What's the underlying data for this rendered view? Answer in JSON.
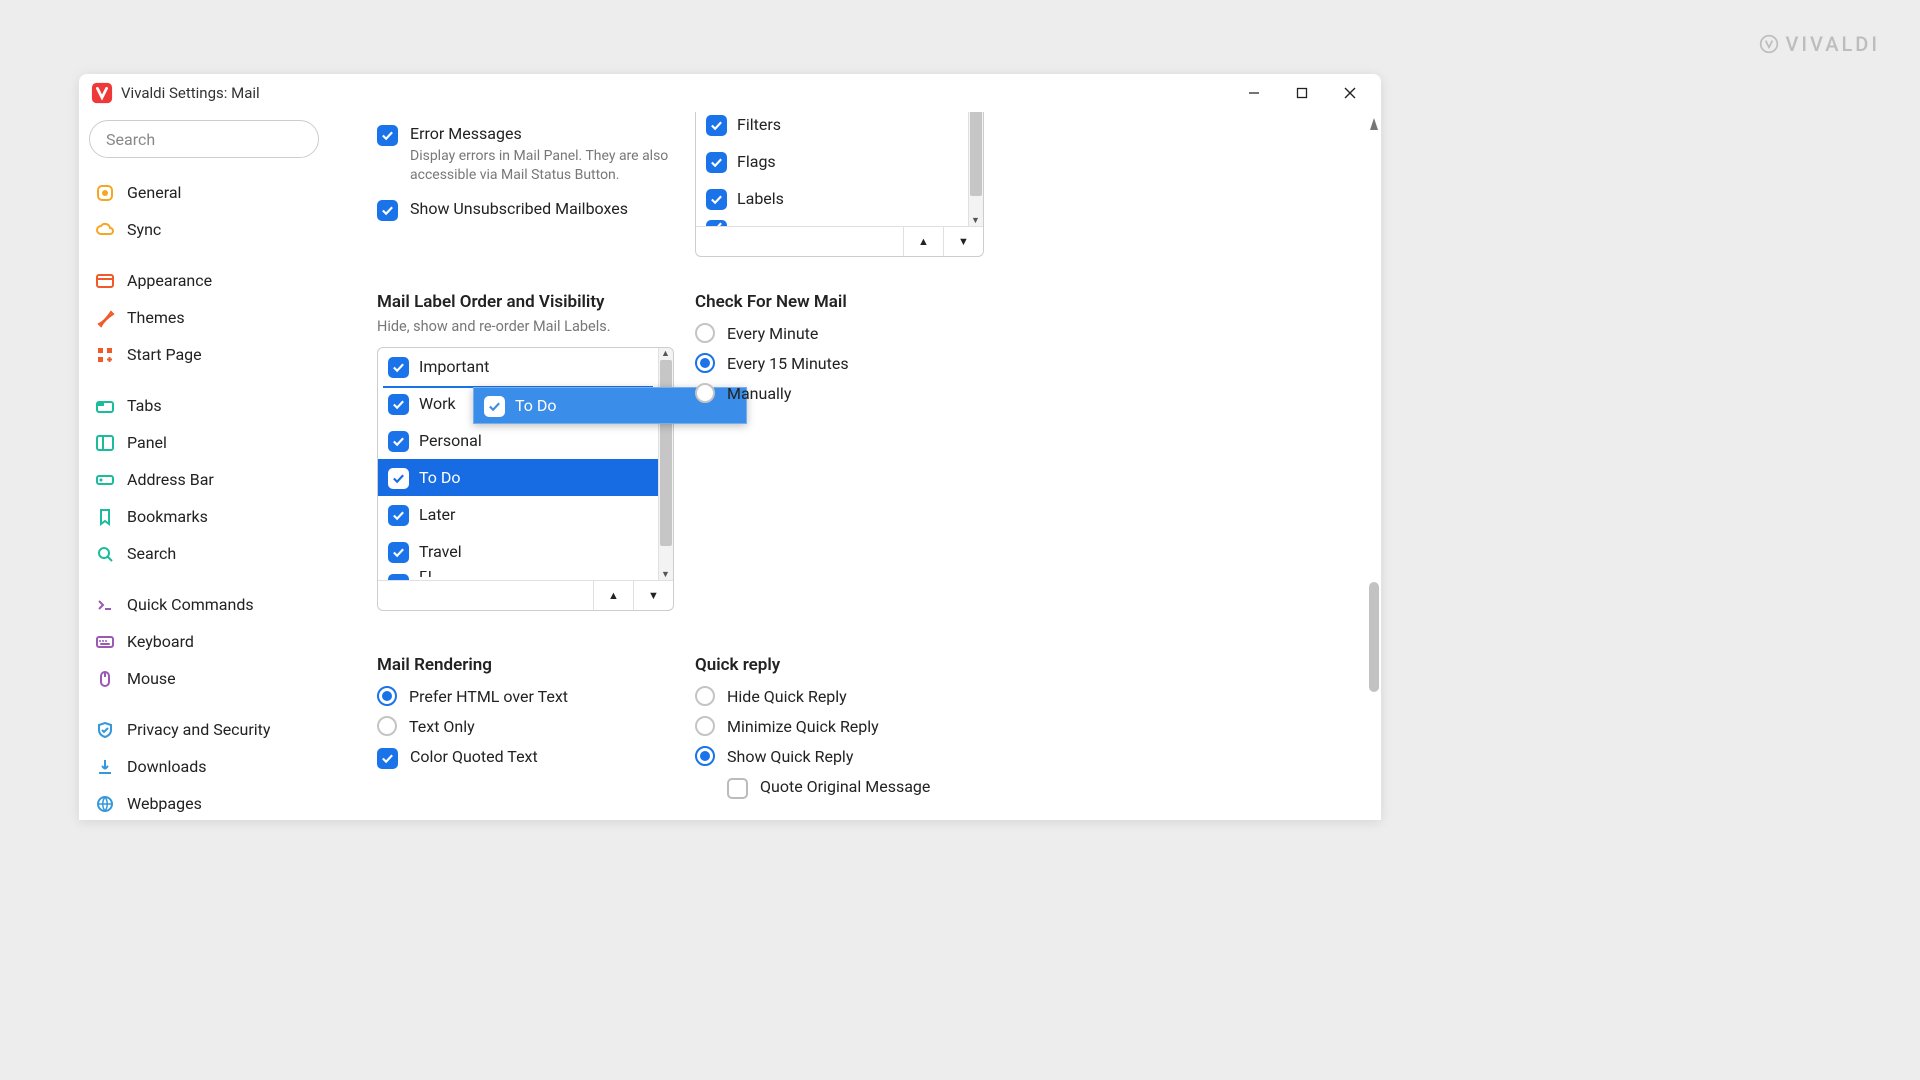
{
  "brand": "VIVALDI",
  "window_title": "Vivaldi Settings: Mail",
  "search_placeholder": "Search",
  "sidebar": {
    "items": [
      {
        "label": "General",
        "icon": "gear",
        "color": "#f5a623"
      },
      {
        "label": "Sync",
        "icon": "cloud",
        "color": "#f5a623"
      },
      {
        "gap": true
      },
      {
        "label": "Appearance",
        "icon": "layout",
        "color": "#f05a28"
      },
      {
        "label": "Themes",
        "icon": "brush",
        "color": "#f05a28"
      },
      {
        "label": "Start Page",
        "icon": "grid",
        "color": "#f05a28"
      },
      {
        "gap": true
      },
      {
        "label": "Tabs",
        "icon": "tabs",
        "color": "#1abc9c"
      },
      {
        "label": "Panel",
        "icon": "panel",
        "color": "#1abc9c"
      },
      {
        "label": "Address Bar",
        "icon": "address",
        "color": "#1abc9c"
      },
      {
        "label": "Bookmarks",
        "icon": "bookmark",
        "color": "#1abc9c"
      },
      {
        "label": "Search",
        "icon": "magnify",
        "color": "#1abc9c"
      },
      {
        "gap": true
      },
      {
        "label": "Quick Commands",
        "icon": "prompt",
        "color": "#9b59b6"
      },
      {
        "label": "Keyboard",
        "icon": "keyboard",
        "color": "#9b59b6"
      },
      {
        "label": "Mouse",
        "icon": "mouse",
        "color": "#9b59b6"
      },
      {
        "gap": true
      },
      {
        "label": "Privacy and Security",
        "icon": "shield",
        "color": "#3498db"
      },
      {
        "label": "Downloads",
        "icon": "download",
        "color": "#3498db"
      },
      {
        "label": "Webpages",
        "icon": "globe",
        "color": "#3498db"
      }
    ]
  },
  "top_checks": {
    "error": {
      "label": "Error Messages",
      "sub": "Display errors in Mail Panel. They are also accessible via Mail Status Button."
    },
    "unsub": {
      "label": "Show Unsubscribed Mailboxes"
    }
  },
  "panel_list1": [
    "Filters",
    "Flags",
    "Labels"
  ],
  "labels_section": {
    "title": "Mail Label Order and Visibility",
    "sub": "Hide, show and re-order Mail Labels."
  },
  "labels_list": [
    "Important",
    "Work",
    "Personal",
    "To Do",
    "Later",
    "Travel"
  ],
  "labels_partial": "Fl",
  "labels_dragging": "To Do",
  "check_mail": {
    "title": "Check For New Mail",
    "opts": [
      "Every Minute",
      "Every 15 Minutes",
      "Manually"
    ],
    "selected": "Every 15 Minutes"
  },
  "rendering": {
    "title": "Mail Rendering",
    "opts": [
      "Prefer HTML over Text",
      "Text Only"
    ],
    "selected": "Prefer HTML over Text",
    "color_quoted": "Color Quoted Text"
  },
  "quick_reply": {
    "title": "Quick reply",
    "opts": [
      "Hide Quick Reply",
      "Minimize Quick Reply",
      "Show Quick Reply"
    ],
    "selected": "Show Quick Reply",
    "quote": "Quote Original Message"
  }
}
